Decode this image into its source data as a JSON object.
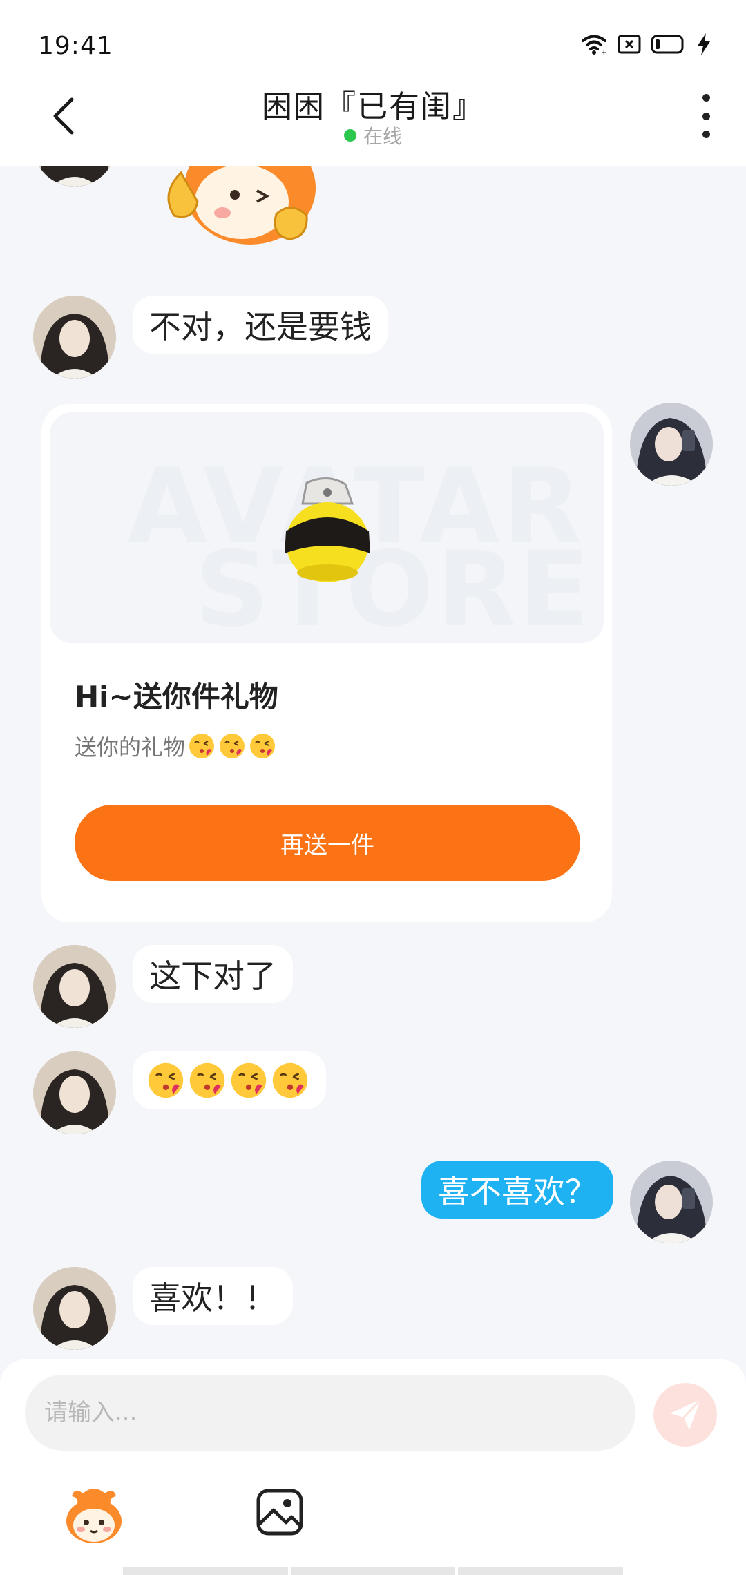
{
  "status_bar": {
    "time": "19:41",
    "icons": [
      "wifi-icon",
      "sim-icon",
      "battery-icon",
      "charging-icon"
    ]
  },
  "header": {
    "title": "困困『已有闺』",
    "presence": "在线",
    "back_icon": "chevron-left-icon",
    "more_icon": "more-vertical-icon"
  },
  "messages": [
    {
      "from": "other",
      "type": "text",
      "text": "不对，还是要钱"
    },
    {
      "from": "me",
      "type": "gift",
      "watermark": [
        "AVATAR",
        "STORE"
      ],
      "title": "Hi~送你件礼物",
      "desc": "送你的礼物",
      "desc_emoji": "kissing-face-emoji",
      "desc_emoji_count": 3,
      "button": "再送一件"
    },
    {
      "from": "other",
      "type": "text",
      "text": "这下对了"
    },
    {
      "from": "other",
      "type": "emoji",
      "emoji": "kissing-face-emoji",
      "count": 4
    },
    {
      "from": "me",
      "type": "text",
      "text": "喜不喜欢？"
    },
    {
      "from": "other",
      "type": "text",
      "text": "喜欢！！"
    }
  ],
  "composer": {
    "placeholder": "请输入...",
    "send_icon": "paper-plane-icon",
    "tools": [
      "sticker-icon",
      "image-icon"
    ]
  },
  "colors": {
    "accent_orange": "#fc7316",
    "my_bubble": "#1fb2f3",
    "online_dot": "#2cc84d",
    "chat_bg": "#f4f6f9"
  }
}
